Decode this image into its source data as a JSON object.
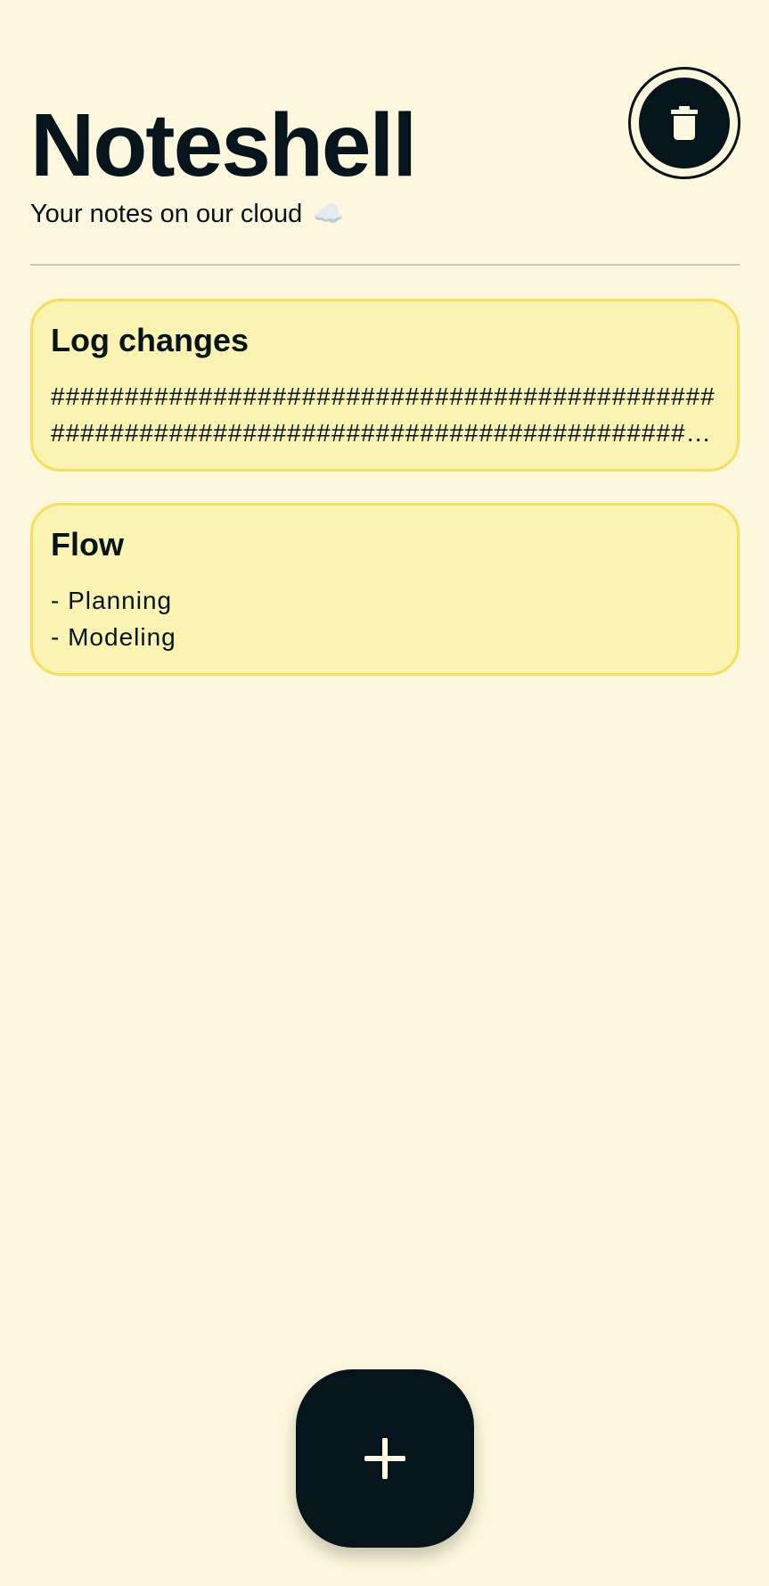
{
  "app": {
    "title": "Noteshell",
    "subtitle": "Your notes on our cloud",
    "subtitle_emoji": "☁️"
  },
  "toolbar": {
    "delete_icon": "trash-icon"
  },
  "notes": [
    {
      "title": "Log changes",
      "body": "########################################################################################…"
    },
    {
      "title": "Flow",
      "body": "- Planning\n- Modeling"
    }
  ],
  "fab": {
    "icon": "plus-icon"
  },
  "colors": {
    "background": "#fdf8dd",
    "card_fill": "#fbf3b2",
    "card_border": "#f5e05a",
    "ink": "#06141b",
    "divider": "#c6c9b3"
  }
}
